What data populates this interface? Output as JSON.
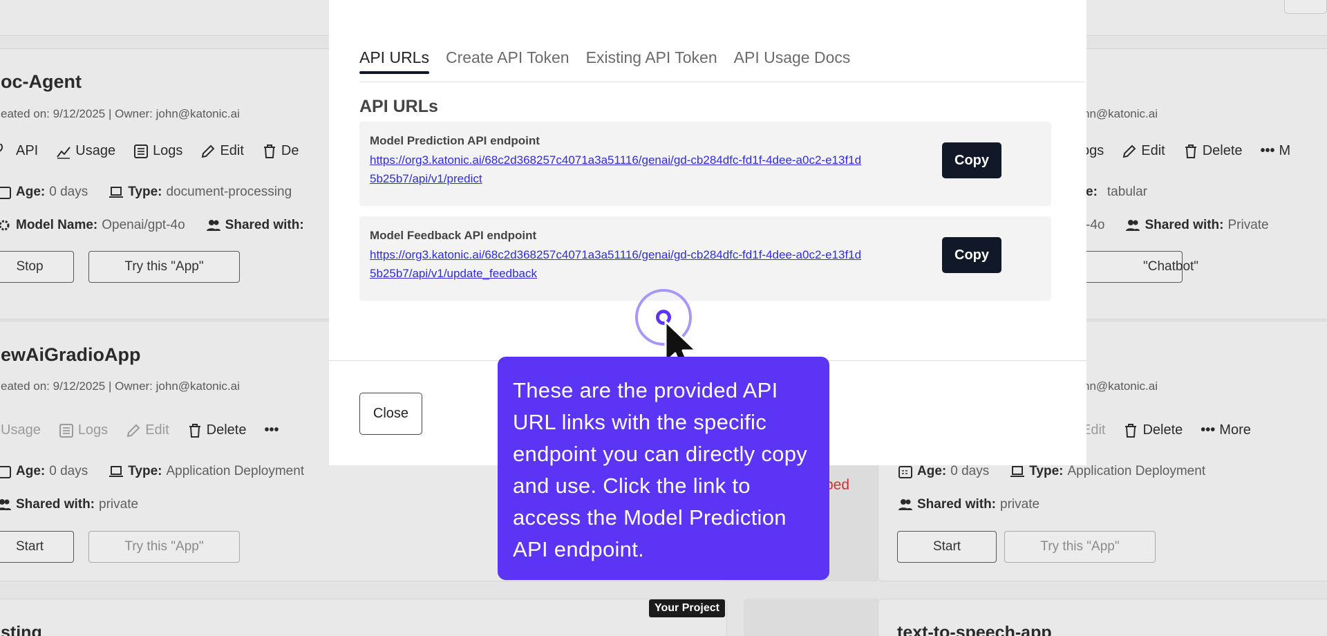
{
  "cards": [
    {
      "title": "oc-Agent",
      "meta": "eated on: 9/12/2025 | Owner: john@katonic.ai",
      "actions": [
        "API",
        "Usage",
        "Logs",
        "Edit",
        "De"
      ],
      "age_label": "Age:",
      "age_value": "0 days",
      "type_label": "Type:",
      "type_value": "document-processing",
      "model_label": "Model Name:",
      "model_value": "Openai/gpt-4o",
      "shared_label": "Shared with:",
      "shared_value": "",
      "btn_primary": "Stop",
      "btn_secondary": "Try this \"App\""
    },
    {
      "meta": "hn@katonic.ai",
      "actions": [
        "ogs",
        "Edit",
        "Delete",
        "M"
      ],
      "type_label": "e:",
      "type_value": "tabular",
      "model_value": "-4o",
      "shared_label": "Shared with:",
      "shared_value": "Private",
      "btn_secondary": "\"Chatbot\""
    },
    {
      "title": "ewAiGradioApp",
      "meta": "eated on: 9/12/2025 | Owner: john@katonic.ai",
      "actions": [
        "Usage",
        "Logs",
        "Edit",
        "Delete",
        "•••"
      ],
      "age_label": "Age:",
      "age_value": "0 days",
      "type_label": "Type:",
      "type_value": "Application Deployment",
      "shared_label": "Shared with:",
      "shared_value": "private",
      "btn_primary": "Start",
      "btn_secondary": "Try this \"App\""
    },
    {
      "meta": "hn@katonic.ai",
      "actions": [
        "Edit",
        "Delete",
        "More"
      ],
      "age_label": "Age:",
      "age_value": "0 days",
      "type_label": "Type:",
      "type_value": "Application Deployment",
      "shared_label": "Shared with:",
      "shared_value": "private",
      "btn_primary": "Start",
      "btn_secondary": "Try this \"App\"",
      "status": "ped"
    },
    {
      "title": "sting",
      "badge": "Your Project"
    },
    {
      "title": "text-to-speech-app"
    }
  ],
  "modal": {
    "tabs": [
      "API URLs",
      "Create API Token",
      "Existing API Token",
      "API Usage Docs"
    ],
    "active_tab": 0,
    "section_title": "API URLs",
    "endpoints": [
      {
        "label": "Model Prediction API endpoint",
        "url": "https://org3.katonic.ai/68c2d368257c4071a3a51116/genai/gd-cb284dfc-fd1f-4dee-a0c2-e13f1d5b25b7/api/v1/predict",
        "copy_label": "Copy"
      },
      {
        "label": "Model Feedback API endpoint",
        "url": "https://org3.katonic.ai/68c2d368257c4071a3a51116/genai/gd-cb284dfc-fd1f-4dee-a0c2-e13f1d5b25b7/api/v1/update_feedback",
        "copy_label": "Copy"
      }
    ],
    "close_label": "Close"
  },
  "tooltip": {
    "text": "These are the provided API URL links with the specific endpoint you can directly copy and use. Click the link to access the Model Prediction API endpoint."
  },
  "colors": {
    "accent": "#5b34f6",
    "button_dark": "#111827",
    "link": "#2f2cd8",
    "status_red": "#d32f2f"
  }
}
